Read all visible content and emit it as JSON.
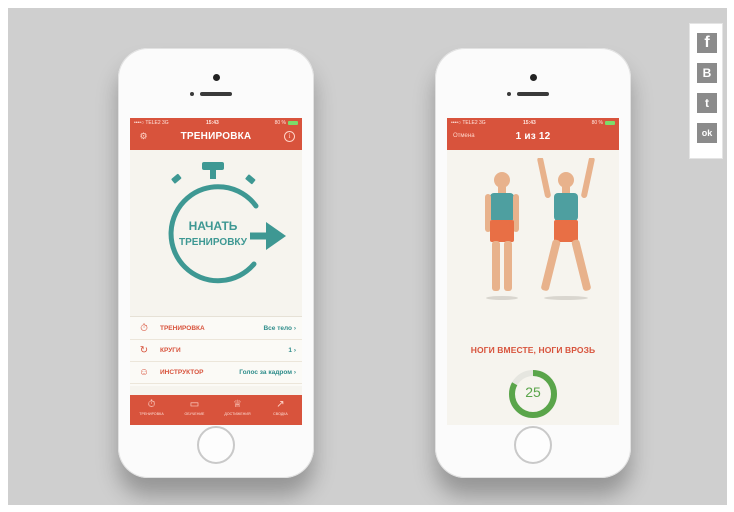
{
  "colors": {
    "app_red": "#d8533c",
    "teal": "#2f8d8b",
    "timer_green": "#5aa54a",
    "background": "#cfcfcf"
  },
  "phone1": {
    "status": {
      "carrier": "••••○ TELE2  3G",
      "time": "15:43",
      "battery": "80 %"
    },
    "nav": {
      "title": "ТРЕНИРОВКА",
      "left_icon": "gear-icon",
      "right_icon": "info-icon"
    },
    "start_button": {
      "line1": "НАЧАТЬ",
      "line2": "ТРЕНИРОВКУ"
    },
    "settings": [
      {
        "icon": "stopwatch-icon",
        "label": "ТРЕНИРОВКА",
        "value": "Все тело"
      },
      {
        "icon": "refresh-icon",
        "label": "КРУГИ",
        "value": "1"
      },
      {
        "icon": "coach-icon",
        "label": "ИНСТРУКТОР",
        "value": "Голос за кадром"
      }
    ],
    "tabs": [
      {
        "icon": "stopwatch-icon",
        "label": "ТРЕНИРОВКА"
      },
      {
        "icon": "book-icon",
        "label": "ОБУЧЕНИЕ"
      },
      {
        "icon": "trophy-icon",
        "label": "ДОСТИЖЕНИЯ"
      },
      {
        "icon": "chart-icon",
        "label": "СВОДКА"
      }
    ]
  },
  "phone2": {
    "status": {
      "carrier": "••••○ TELE2  3G",
      "time": "15:43",
      "battery": "80 %"
    },
    "nav": {
      "cancel": "Отмена",
      "title": "1 из 12"
    },
    "exercise": "НОГИ ВМЕСТЕ, НОГИ ВРОЗЬ",
    "countdown": "25",
    "countdown_fraction": 0.83
  },
  "social": [
    {
      "icon": "facebook-icon",
      "glyph": "f"
    },
    {
      "icon": "vkontakte-icon",
      "glyph": "B"
    },
    {
      "icon": "twitter-icon",
      "glyph": "t"
    },
    {
      "icon": "odnoklassniki-icon",
      "glyph": "ok"
    }
  ]
}
